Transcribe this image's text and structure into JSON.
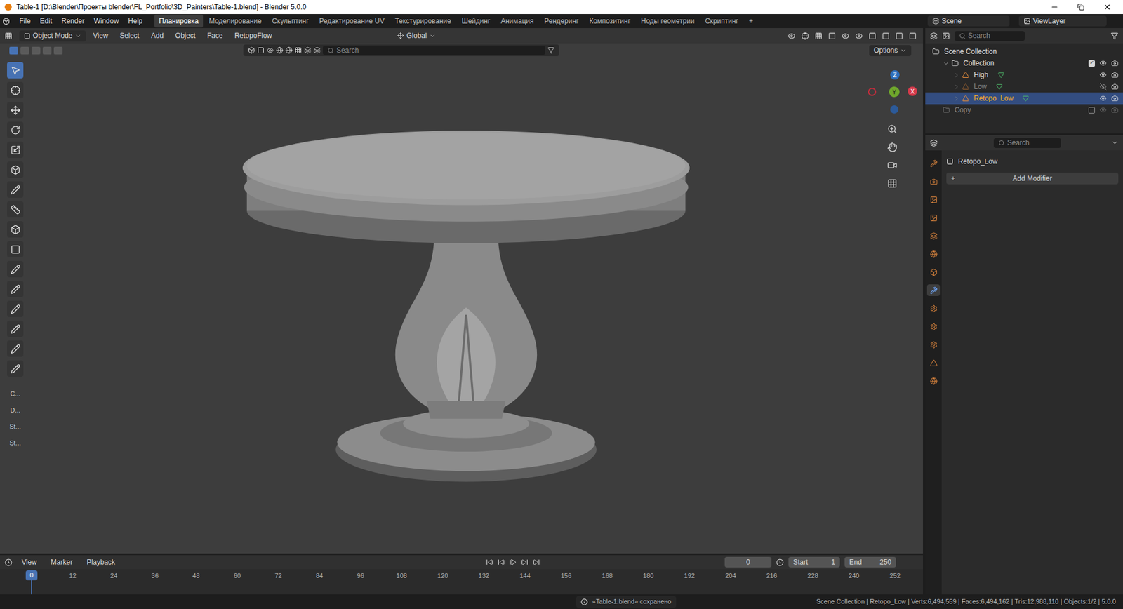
{
  "window": {
    "title": "Table-1 [D:\\Blender\\Проекты blender\\FL_Portfolio\\3D_Painters\\Table-1.blend] - Blender 5.0.0"
  },
  "menu": [
    "File",
    "Edit",
    "Render",
    "Window",
    "Help"
  ],
  "workspaces": [
    {
      "label": "Планировка",
      "selected": true
    },
    {
      "label": "Моделирование",
      "selected": false
    },
    {
      "label": "Скульптинг",
      "selected": false
    },
    {
      "label": "Редактирование UV",
      "selected": false
    },
    {
      "label": "Текстурирование",
      "selected": false
    },
    {
      "label": "Шейдинг",
      "selected": false
    },
    {
      "label": "Анимация",
      "selected": false
    },
    {
      "label": "Рендеринг",
      "selected": false
    },
    {
      "label": "Композитинг",
      "selected": false
    },
    {
      "label": "Ноды геометрии",
      "selected": false
    },
    {
      "label": "Скриптинг",
      "selected": false
    }
  ],
  "add_workspace": "+",
  "scene": "Scene",
  "view_layer": "ViewLayer",
  "viewport": {
    "mode": "Object Mode",
    "menus": [
      "View",
      "Select",
      "Add",
      "Object",
      "Face",
      "RetopoFlow"
    ],
    "orientation": "Global",
    "search_placeholder": "Search",
    "options": "Options",
    "toolbar_labels": [
      "C...",
      "D...",
      "St...",
      "St..."
    ],
    "gizmo": {
      "z": "Z",
      "y": "Y",
      "x": "X"
    }
  },
  "outliner": {
    "search_placeholder": "Search",
    "items": [
      {
        "name": "Scene Collection",
        "kind": "root",
        "depth": 0,
        "selected": false,
        "dimmed": false,
        "visible": true,
        "checked": true
      },
      {
        "name": "Collection",
        "kind": "collection",
        "depth": 1,
        "selected": false,
        "dimmed": false,
        "visible": true,
        "checked": true
      },
      {
        "name": "High",
        "kind": "object",
        "depth": 2,
        "selected": false,
        "dimmed": false,
        "visible": true,
        "checked": true
      },
      {
        "name": "Low",
        "kind": "object",
        "depth": 2,
        "selected": false,
        "dimmed": true,
        "visible": false,
        "checked": true
      },
      {
        "name": "Retopo_Low",
        "kind": "object",
        "depth": 2,
        "selected": true,
        "dimmed": false,
        "visible": true,
        "checked": true
      },
      {
        "name": "Copy",
        "kind": "collection",
        "depth": 1,
        "selected": false,
        "dimmed": true,
        "visible": true,
        "checked": false
      }
    ]
  },
  "properties": {
    "search_placeholder": "Search",
    "object": "Retopo_Low",
    "add_modifier_icon": "+",
    "add_modifier": "Add Modifier"
  },
  "timeline": {
    "menus": [
      "View",
      "Marker",
      "Playback"
    ],
    "frame": "0",
    "start_label": "Start",
    "start": "1",
    "end_label": "End",
    "end": "250",
    "current": "0",
    "ticks": [
      "0",
      "12",
      "24",
      "36",
      "48",
      "60",
      "72",
      "84",
      "96",
      "108",
      "120",
      "132",
      "144",
      "156",
      "168",
      "180",
      "192",
      "204",
      "216",
      "228",
      "240",
      "252"
    ]
  },
  "status_bar": {
    "message": "«Table-1.blend» сохранено",
    "stats": "Scene Collection | Retopo_Low | Verts:6,494,559 | Faces:6,494,162 | Tris:12,988,110 | Objects:1/2 | 5.0.0"
  }
}
